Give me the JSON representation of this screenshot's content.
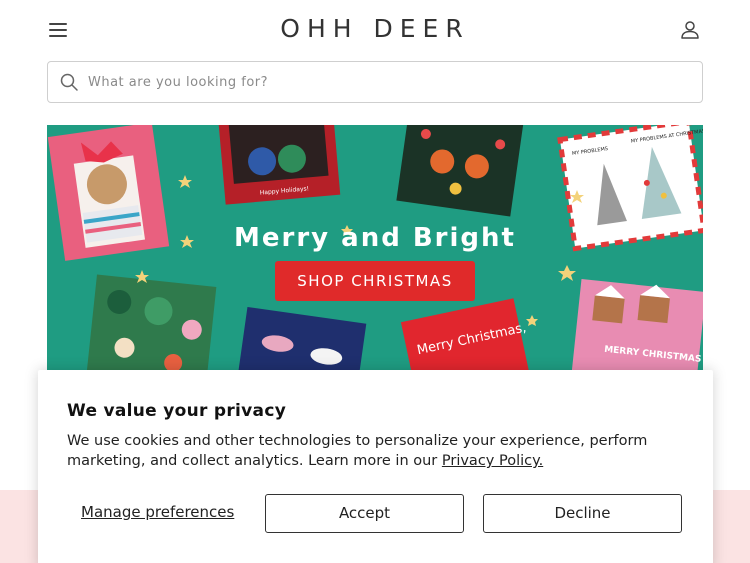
{
  "header": {
    "logo": "OHH DEER"
  },
  "search": {
    "placeholder": "What are you looking for?",
    "value": ""
  },
  "hero": {
    "title": "Merry and Bright",
    "button_label": "SHOP CHRISTMAS",
    "card_texts": {
      "happy_holidays": "Happy Holidays!",
      "my_problems": "MY PROBLEMS",
      "my_problems_christmas": "MY PROBLEMS AT CHRISTMAS",
      "merry_christmas_red": "Merry Christmas,",
      "merry_christmas_pink": "MERRY CHRISTMAS Y'ALL!"
    },
    "colors": {
      "background": "#1f9c82",
      "button": "#e02a2a"
    }
  },
  "cookie_banner": {
    "title": "We value your privacy",
    "body": "We use cookies and other technologies to personalize your experience, perform marketing, and collect analytics. Learn more in our ",
    "policy_link": "Privacy Policy.",
    "manage_label": "Manage preferences",
    "accept_label": "Accept",
    "decline_label": "Decline"
  },
  "icons": {
    "menu": "hamburger-menu-icon",
    "account": "user-account-icon",
    "search": "search-icon"
  }
}
